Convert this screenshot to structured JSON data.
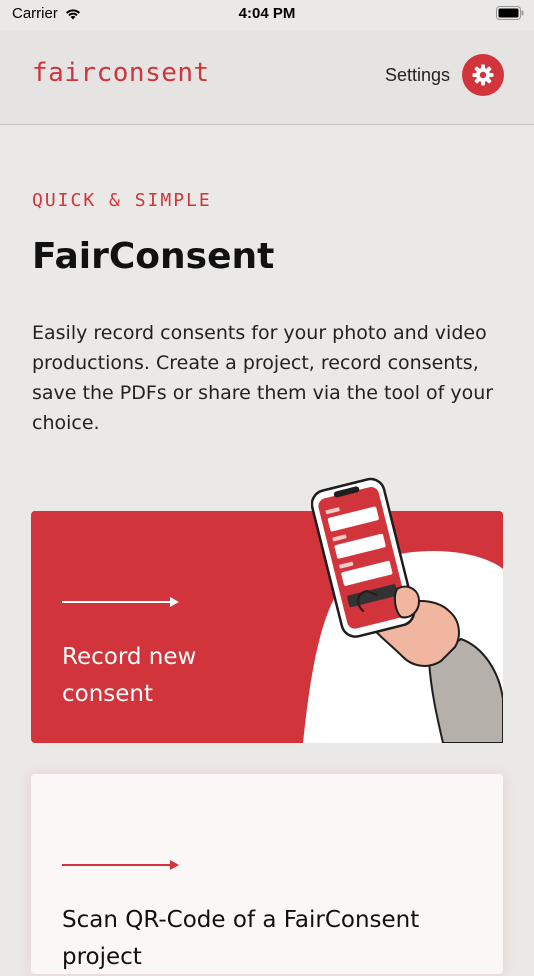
{
  "status_bar": {
    "carrier": "Carrier",
    "time": "4:04 PM"
  },
  "header": {
    "brand": "fairconsent",
    "settings_label": "Settings",
    "settings_icon": "gear-icon"
  },
  "intro": {
    "eyebrow": "QUICK & SIMPLE",
    "title": "FairConsent",
    "description": "Easily record consents for your photo and video productions. Create a project, record consents, save the PDFs or share them via the tool of your choice."
  },
  "cards": [
    {
      "label": "Record new consent",
      "icon": "arrow-right-icon"
    },
    {
      "label": "Scan QR-Code of a FairConsent project",
      "icon": "arrow-right-icon"
    }
  ],
  "colors": {
    "accent": "#d1343b",
    "background": "#ebe9e7",
    "nav_background": "#e6e4e2"
  }
}
